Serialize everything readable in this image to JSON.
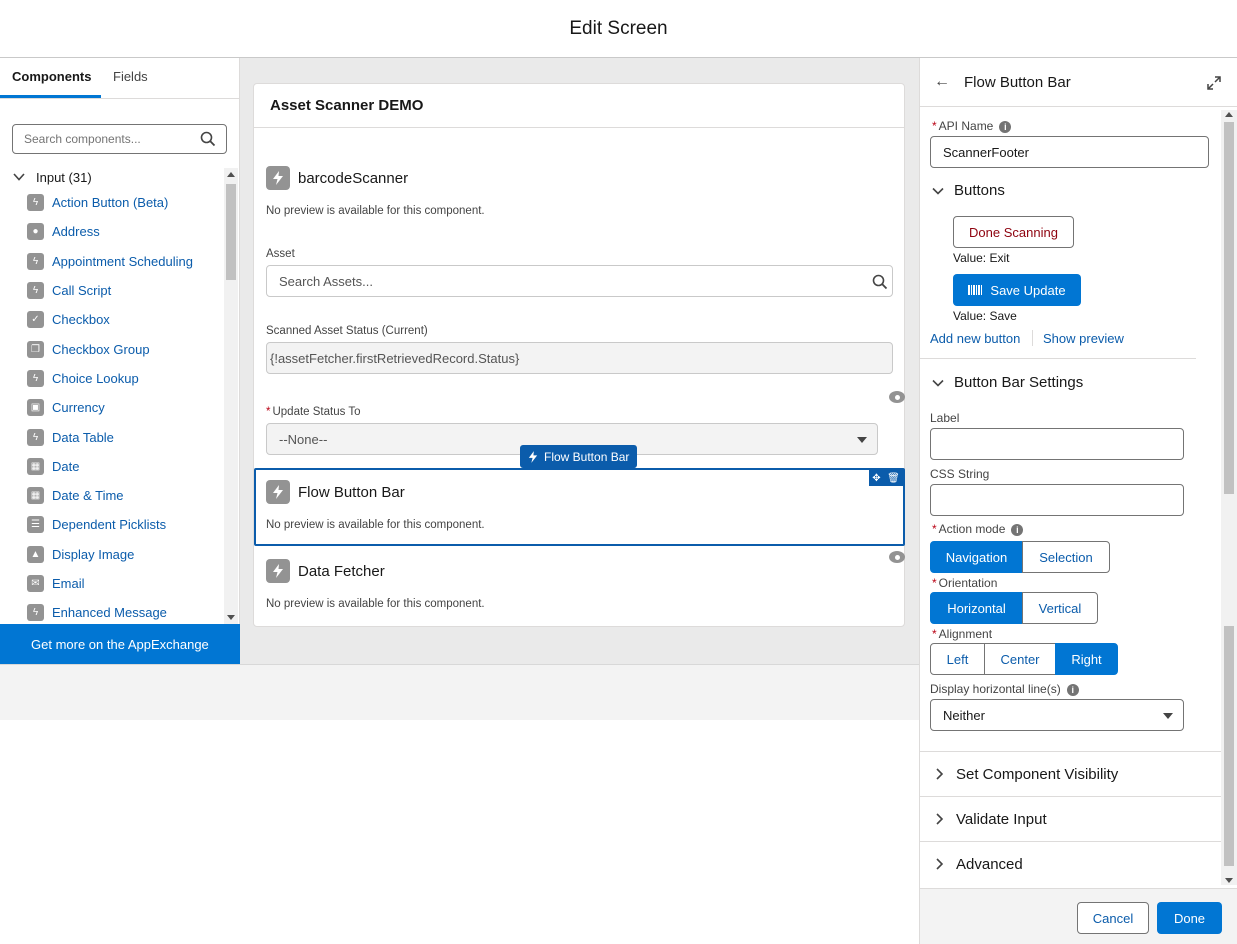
{
  "header": {
    "title": "Edit Screen"
  },
  "left": {
    "tabs": [
      {
        "label": "Components"
      },
      {
        "label": "Fields"
      }
    ],
    "search_placeholder": "Search components...",
    "group": "Input (31)",
    "items": [
      {
        "label": "Action Button (Beta)",
        "icon": "bolt-icon"
      },
      {
        "label": "Address",
        "icon": "location-pin-icon"
      },
      {
        "label": "Appointment Scheduling",
        "icon": "bolt-icon"
      },
      {
        "label": "Call Script",
        "icon": "bolt-icon"
      },
      {
        "label": "Checkbox",
        "icon": "checkmark-icon"
      },
      {
        "label": "Checkbox Group",
        "icon": "checkbox-group-icon"
      },
      {
        "label": "Choice Lookup",
        "icon": "bolt-icon"
      },
      {
        "label": "Currency",
        "icon": "currency-icon"
      },
      {
        "label": "Data Table",
        "icon": "bolt-icon"
      },
      {
        "label": "Date",
        "icon": "calendar-icon"
      },
      {
        "label": "Date & Time",
        "icon": "calendar-clock-icon"
      },
      {
        "label": "Dependent Picklists",
        "icon": "list-icon"
      },
      {
        "label": "Display Image",
        "icon": "image-icon"
      },
      {
        "label": "Email",
        "icon": "email-icon"
      },
      {
        "label": "Enhanced Message",
        "icon": "bolt-icon"
      }
    ],
    "appexchange": "Get more on the AppExchange"
  },
  "canvas": {
    "card_title": "Asset Scanner DEMO",
    "barcode": {
      "title": "barcodeScanner",
      "note": "No preview is available for this component."
    },
    "asset": {
      "label": "Asset",
      "placeholder": "Search Assets..."
    },
    "status": {
      "label": "Scanned Asset Status (Current)",
      "value": "{!assetFetcher.firstRetrievedRecord.Status}"
    },
    "update": {
      "required": "*",
      "label": "Update Status To",
      "value": "--None--"
    },
    "badge": "Flow Button Bar",
    "flowbar": {
      "title": "Flow Button Bar",
      "note": "No preview is available for this component."
    },
    "fetcher": {
      "title": "Data Fetcher",
      "note": "No preview is available for this component."
    }
  },
  "right": {
    "title": "Flow Button Bar",
    "api_label": "API Name",
    "api_value": "ScannerFooter",
    "buttons_section": "Buttons",
    "btn1": {
      "label": "Done Scanning",
      "value": "Value: Exit"
    },
    "btn2": {
      "label": "Save Update",
      "value": "Value: Save"
    },
    "add_new": "Add new button",
    "show_preview": "Show preview",
    "settings_section": "Button Bar Settings",
    "label_label": "Label",
    "css_label": "CSS String",
    "action_mode_label": "Action mode",
    "action_mode_options": [
      "Navigation",
      "Selection"
    ],
    "orientation_label": "Orientation",
    "orientation_options": [
      "Horizontal",
      "Vertical"
    ],
    "alignment_label": "Alignment",
    "alignment_options": [
      "Left",
      "Center",
      "Right"
    ],
    "hline_label": "Display horizontal line(s)",
    "hline_value": "Neither",
    "collapsed": [
      "Set Component Visibility",
      "Validate Input",
      "Advanced"
    ],
    "cancel": "Cancel",
    "done": "Done"
  }
}
